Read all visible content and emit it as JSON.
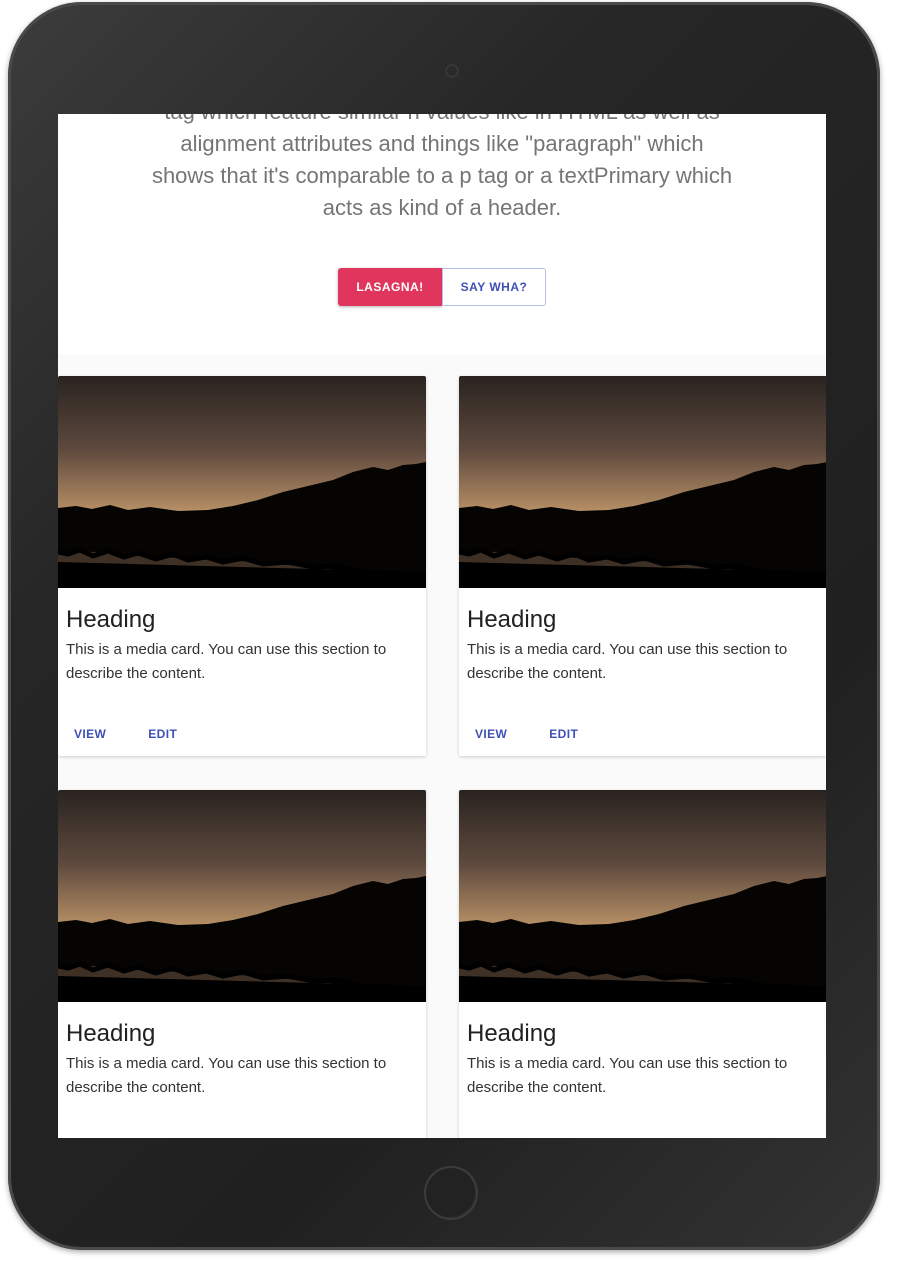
{
  "hero": {
    "text": "tag which feature similar h values like in HTML as well as alignment attributes and things like \"paragraph\" which shows that it's comparable to a p tag or a textPrimary which acts as kind of a header.",
    "primary_button": "LASAGNA!",
    "secondary_button": "SAY WHA?"
  },
  "cards": [
    {
      "heading": "Heading",
      "description": "This is a media card. You can use this section to describe the content.",
      "view": "VIEW",
      "edit": "EDIT"
    },
    {
      "heading": "Heading",
      "description": "This is a media card. You can use this section to describe the content.",
      "view": "VIEW",
      "edit": "EDIT"
    },
    {
      "heading": "Heading",
      "description": "This is a media card. You can use this section to describe the content."
    },
    {
      "heading": "Heading",
      "description": "This is a media card. You can use this section to describe the content."
    }
  ],
  "colors": {
    "primary_button": "#e0365e",
    "action_text": "#3f51b5",
    "hero_text": "#757575"
  }
}
